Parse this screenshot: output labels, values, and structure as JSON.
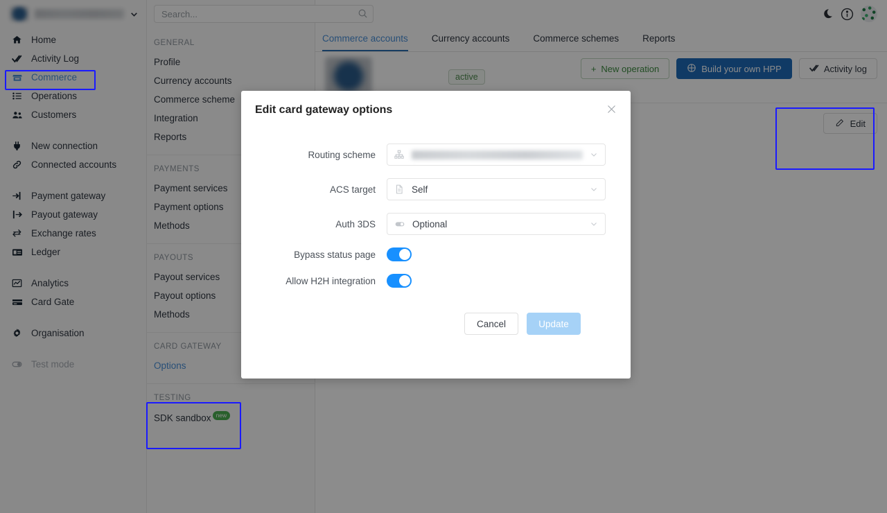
{
  "header": {
    "search_placeholder": "Search...",
    "search_value": "",
    "icons": {
      "theme": "moon-icon",
      "info": "info-icon",
      "avatar": "user-avatar"
    }
  },
  "brand": {
    "name": "",
    "chevron": "chevron-down-icon"
  },
  "sidebar": {
    "groups": [
      {
        "items": [
          {
            "label": "Home",
            "icon": "home-icon",
            "state": "normal"
          },
          {
            "label": "Activity Log",
            "icon": "check-double-icon",
            "state": "normal"
          },
          {
            "label": "Commerce",
            "icon": "store-icon",
            "state": "active"
          },
          {
            "label": "Operations",
            "icon": "list-icon",
            "state": "normal"
          },
          {
            "label": "Customers",
            "icon": "users-icon",
            "state": "normal"
          }
        ]
      },
      {
        "items": [
          {
            "label": "New connection",
            "icon": "plug-icon",
            "state": "normal"
          },
          {
            "label": "Connected accounts",
            "icon": "link-icon",
            "state": "normal"
          }
        ]
      },
      {
        "items": [
          {
            "label": "Payment gateway",
            "icon": "sign-in-icon",
            "state": "normal"
          },
          {
            "label": "Payout gateway",
            "icon": "sign-out-icon",
            "state": "normal"
          },
          {
            "label": "Exchange rates",
            "icon": "exchange-icon",
            "state": "normal"
          },
          {
            "label": "Ledger",
            "icon": "ledger-icon",
            "state": "normal"
          }
        ]
      },
      {
        "items": [
          {
            "label": "Analytics",
            "icon": "chart-icon",
            "state": "normal"
          },
          {
            "label": "Card Gate",
            "icon": "card-icon",
            "state": "normal"
          }
        ]
      },
      {
        "items": [
          {
            "label": "Organisation",
            "icon": "gear-icon",
            "state": "normal"
          }
        ]
      },
      {
        "items": [
          {
            "label": "Test mode",
            "icon": "toggle-icon",
            "state": "muted"
          }
        ]
      }
    ]
  },
  "subnav": {
    "sections": [
      {
        "title": "GENERAL",
        "items": [
          {
            "label": "Profile",
            "style": "normal"
          },
          {
            "label": "Currency accounts",
            "style": "normal"
          },
          {
            "label": "Commerce scheme",
            "style": "normal"
          },
          {
            "label": "Integration",
            "style": "normal"
          },
          {
            "label": "Reports",
            "style": "normal"
          }
        ]
      },
      {
        "title": "PAYMENTS",
        "items": [
          {
            "label": "Payment services",
            "style": "normal"
          },
          {
            "label": "Payment options",
            "style": "normal"
          },
          {
            "label": "Methods",
            "style": "normal"
          }
        ]
      },
      {
        "title": "PAYOUTS",
        "items": [
          {
            "label": "Payout services",
            "style": "normal"
          },
          {
            "label": "Payout options",
            "style": "normal"
          },
          {
            "label": "Methods",
            "style": "normal"
          }
        ]
      },
      {
        "title": "CARD GATEWAY",
        "items": [
          {
            "label": "Options",
            "style": "link"
          }
        ]
      },
      {
        "title": "TESTING",
        "items": [
          {
            "label": "SDK sandbox",
            "style": "normal",
            "badge": "new"
          }
        ]
      }
    ]
  },
  "tabs": [
    {
      "label": "Commerce accounts",
      "active": true
    },
    {
      "label": "Currency accounts",
      "active": false
    },
    {
      "label": "Commerce schemes",
      "active": false
    },
    {
      "label": "Reports",
      "active": false
    }
  ],
  "account": {
    "name": "",
    "status": "active"
  },
  "toolbar": {
    "new_operation": "New operation",
    "build_hpp": "Build your own HPP",
    "activity_log": "Activity log",
    "edit": "Edit"
  },
  "modal": {
    "title": "Edit card gateway options",
    "close_icon": "close-icon",
    "fields": [
      {
        "label": "Routing scheme",
        "value": "",
        "blurred": true,
        "icon": "sitemap-icon",
        "type": "select"
      },
      {
        "label": "ACS target",
        "value": "Self",
        "blurred": false,
        "icon": "document-icon",
        "type": "select"
      },
      {
        "label": "Auth 3DS",
        "value": "Optional",
        "blurred": false,
        "icon": "toggle-icon",
        "type": "select"
      }
    ],
    "switches": [
      {
        "label": "Bypass status page",
        "on": true
      },
      {
        "label": "Allow H2H integration",
        "on": true
      }
    ],
    "cancel": "Cancel",
    "update": "Update",
    "update_disabled": true
  },
  "colors": {
    "accent_blue": "#4a90d9",
    "primary_button": "#1e6bb8",
    "switch_on": "#1890ff",
    "update_disabled": "#a6d2f7",
    "highlight_box": "#1a1aff",
    "badge_green": "#4caf50",
    "status_green": "#4f8a4f"
  },
  "highlights": [
    {
      "name": "commerce-nav-highlight"
    },
    {
      "name": "card-gateway-highlight"
    },
    {
      "name": "edit-panel-highlight"
    }
  ]
}
